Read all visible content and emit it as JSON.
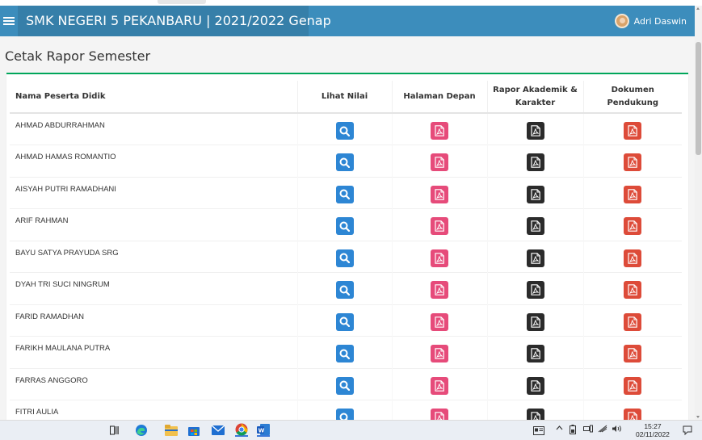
{
  "header": {
    "school_title": "SMK NEGERI 5 PEKANBARU | 2021/2022 Genap",
    "user_name": "Adri Daswin"
  },
  "page": {
    "title": "Cetak Rapor Semester"
  },
  "table": {
    "columns": {
      "name": "Nama Peserta Didik",
      "lihat": "Lihat Nilai",
      "halaman": "Halaman Depan",
      "rapor": "Rapor Akademik & Karakter",
      "dokumen": "Dokumen Pendukung"
    },
    "rows": [
      {
        "name": "AHMAD ABDURRAHMAN"
      },
      {
        "name": "AHMAD HAMAS ROMANTIO"
      },
      {
        "name": "AISYAH PUTRI RAMADHANI"
      },
      {
        "name": "ARIF RAHMAN"
      },
      {
        "name": "BAYU SATYA PRAYUDA SRG"
      },
      {
        "name": "DYAH TRI SUCI NINGRUM"
      },
      {
        "name": "FARID RAMADHAN"
      },
      {
        "name": "FARIKH MAULANA PUTRA"
      },
      {
        "name": "FARRAS ANGGORO"
      },
      {
        "name": "FITRI AULIA"
      }
    ]
  },
  "colors": {
    "navbar": "#3c8dbc",
    "btn_view": "#2d86d4",
    "btn_front": "#e64b7a",
    "btn_report": "#2b2b2b",
    "btn_docs": "#dd4b39",
    "box_border": "#00a65a"
  },
  "icons": {
    "view": "search-icon",
    "pdf": "pdf-file-icon"
  },
  "taskbar": {
    "time": "15:27",
    "date": "02/11/2022"
  }
}
